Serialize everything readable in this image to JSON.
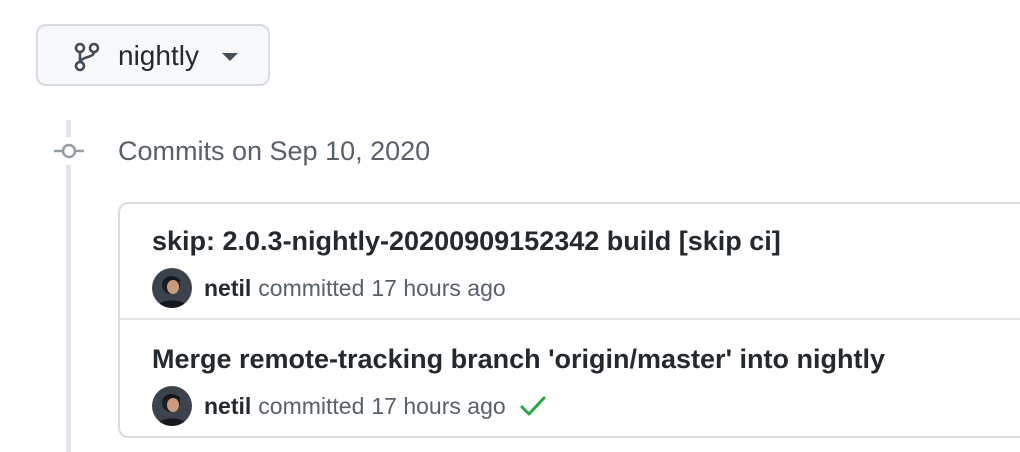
{
  "branch": {
    "icon": "git-branch-icon",
    "name": "nightly",
    "dropdown_icon": "triangle-down-icon"
  },
  "timeline": {
    "node_icon": "git-commit-icon",
    "date_heading": "Commits on Sep 10, 2020"
  },
  "commits": [
    {
      "title": "skip: 2.0.3-nightly-20200909152342 build [skip ci]",
      "author": "netil",
      "action": "committed",
      "time": "17 hours ago",
      "status": null
    },
    {
      "title": "Merge remote-tracking branch 'origin/master' into nightly",
      "author": "netil",
      "action": "committed",
      "time": "17 hours ago",
      "status": "success-check-icon"
    }
  ],
  "colors": {
    "accent_success": "#28a745",
    "border": "#d8dbe0",
    "muted_text": "#586069",
    "primary_text": "#24292e"
  }
}
